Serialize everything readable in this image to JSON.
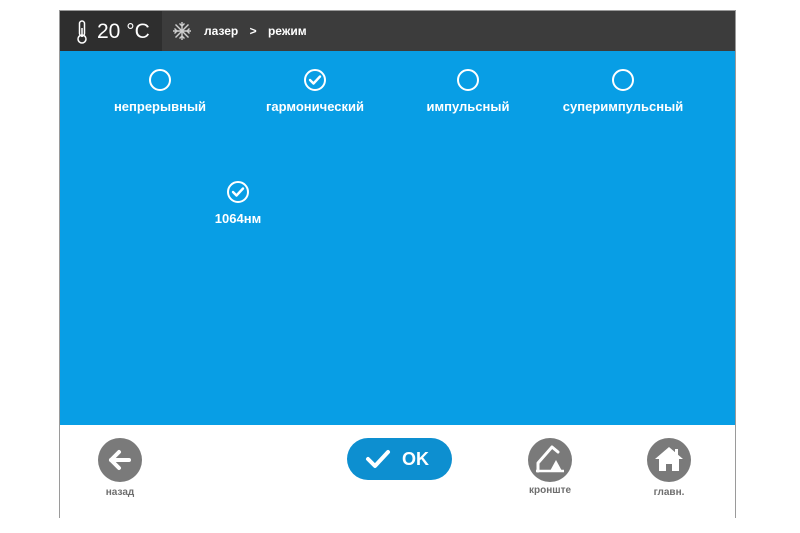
{
  "header": {
    "temperature": "20 °C",
    "breadcrumb": [
      "лазер",
      ">",
      "режим"
    ]
  },
  "modes": [
    {
      "label": "непрерывный",
      "selected": false
    },
    {
      "label": "гармонический",
      "selected": true
    },
    {
      "label": "импульсный",
      "selected": false
    },
    {
      "label": "суперимпульсный",
      "selected": false
    }
  ],
  "wavelengths": [
    {
      "label": "1064нм",
      "selected": true
    }
  ],
  "footer": {
    "back_label": "назад",
    "ok_label": "OK",
    "bracket_label": "кронште",
    "home_label": "главн."
  },
  "colors": {
    "main_bg": "#089ee5",
    "topbar_bg": "#3c3c3c",
    "ok_button": "#0d8fd0",
    "nav_button": "#7a7a7a"
  }
}
